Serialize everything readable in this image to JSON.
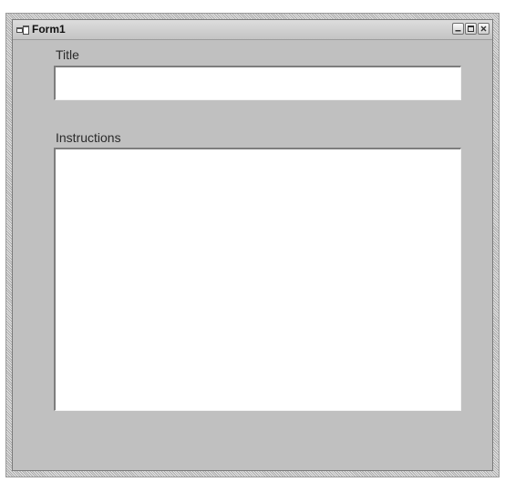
{
  "window": {
    "title": "Form1",
    "title_icon": "form-window-icon",
    "controls": [
      "minimize-icon",
      "maximize-icon",
      "close-icon"
    ]
  },
  "form": {
    "title_label": "Title",
    "title_value": "",
    "instructions_label": "Instructions",
    "instructions_value": ""
  },
  "colors": {
    "client_background": "#c0c0c0",
    "titlebar": "#d0d0d0",
    "textbox_background": "#ffffff"
  }
}
